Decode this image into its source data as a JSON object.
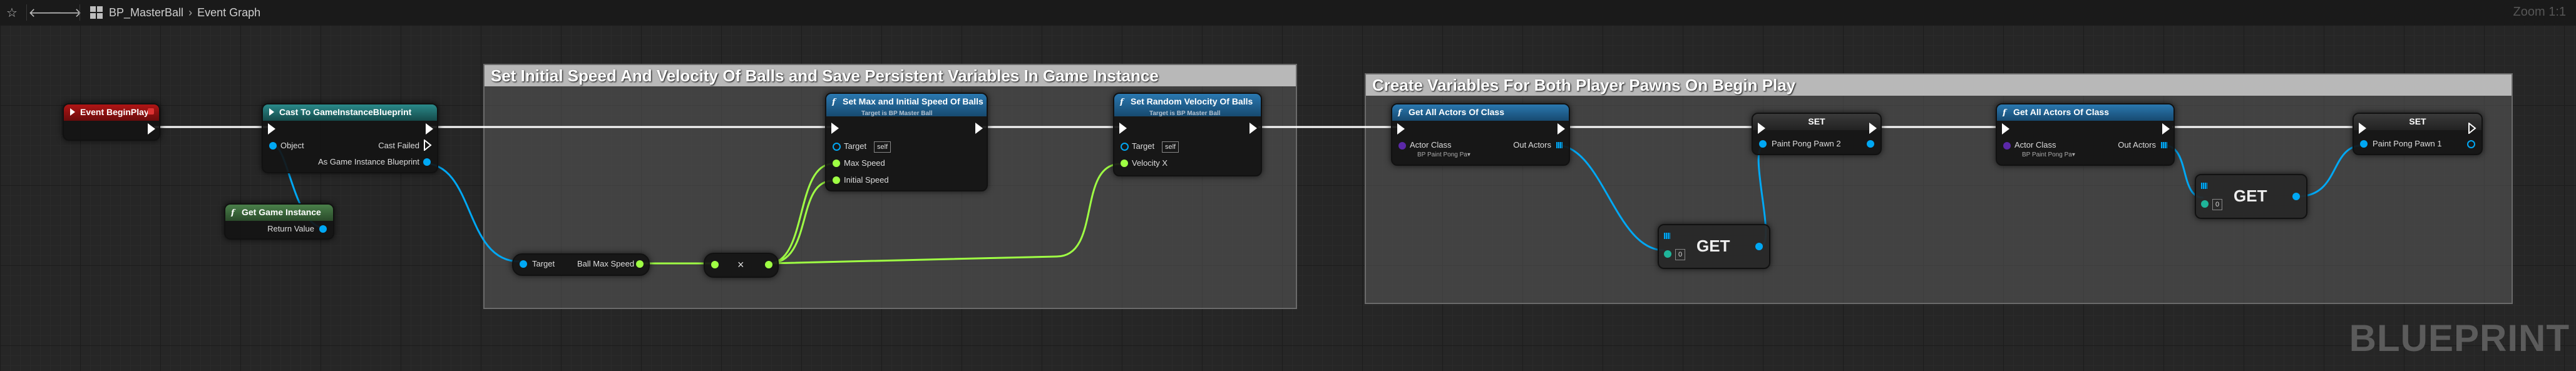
{
  "toolbar": {
    "breadcrumb_asset": "BP_MasterBall",
    "breadcrumb_graph": "Event Graph",
    "zoom": "Zoom 1:1",
    "watermark": "BLUEPRINT"
  },
  "comments": {
    "c1": "Set Initial Speed And Velocity Of Balls and Save Persistent Variables In Game Instance",
    "c2": "Create Variables For Both Player Pawns On Begin Play"
  },
  "nodes": {
    "begin_play": {
      "title": "Event BeginPlay"
    },
    "cast": {
      "title": "Cast To GameInstanceBlueprint",
      "pin_object": "Object",
      "pin_cast_failed": "Cast Failed",
      "pin_out": "As Game Instance Blueprint"
    },
    "get_gi": {
      "title": "Get Game Instance",
      "pin_return": "Return Value"
    },
    "set_speed": {
      "title": "Set Max and Initial Speed Of Balls",
      "subtitle": "Target is BP Master Ball",
      "pin_target": "Target",
      "self": "self",
      "pin_max": "Max Speed",
      "pin_initial": "Initial Speed"
    },
    "set_velocity": {
      "title": "Set Random Velocity Of Balls",
      "subtitle": "Target is BP Master Ball",
      "pin_target": "Target",
      "self": "self",
      "pin_vx": "Velocity X"
    },
    "ball_max": {
      "pin_target": "Target",
      "pin_out": "Ball Max Speed"
    },
    "mult": {
      "op": "×"
    },
    "get_actors_1": {
      "title": "Get All Actors Of Class",
      "pin_class": "Actor Class",
      "class_value": "BP Paint Pong Pa▾",
      "pin_out": "Out Actors"
    },
    "set_pawn2": {
      "title": "SET",
      "pin": "Paint Pong Pawn 2"
    },
    "get_1": {
      "title": "GET",
      "index": "0"
    },
    "get_actors_2": {
      "title": "Get All Actors Of Class",
      "pin_class": "Actor Class",
      "class_value": "BP Paint Pong Pa▾",
      "pin_out": "Out Actors"
    },
    "set_pawn1": {
      "title": "SET",
      "pin": "Paint Pong Pawn 1"
    },
    "get_2": {
      "title": "GET",
      "index": "0"
    }
  },
  "colors": {
    "exec": "#ffffff",
    "object": "#00a8f4",
    "float": "#9fff44",
    "class": "#5b28a8",
    "event_head": "#8a1010",
    "cast_head": "#1d6a6a",
    "func_head": "#1a5c88",
    "pure_head": "#3d6e3d"
  }
}
